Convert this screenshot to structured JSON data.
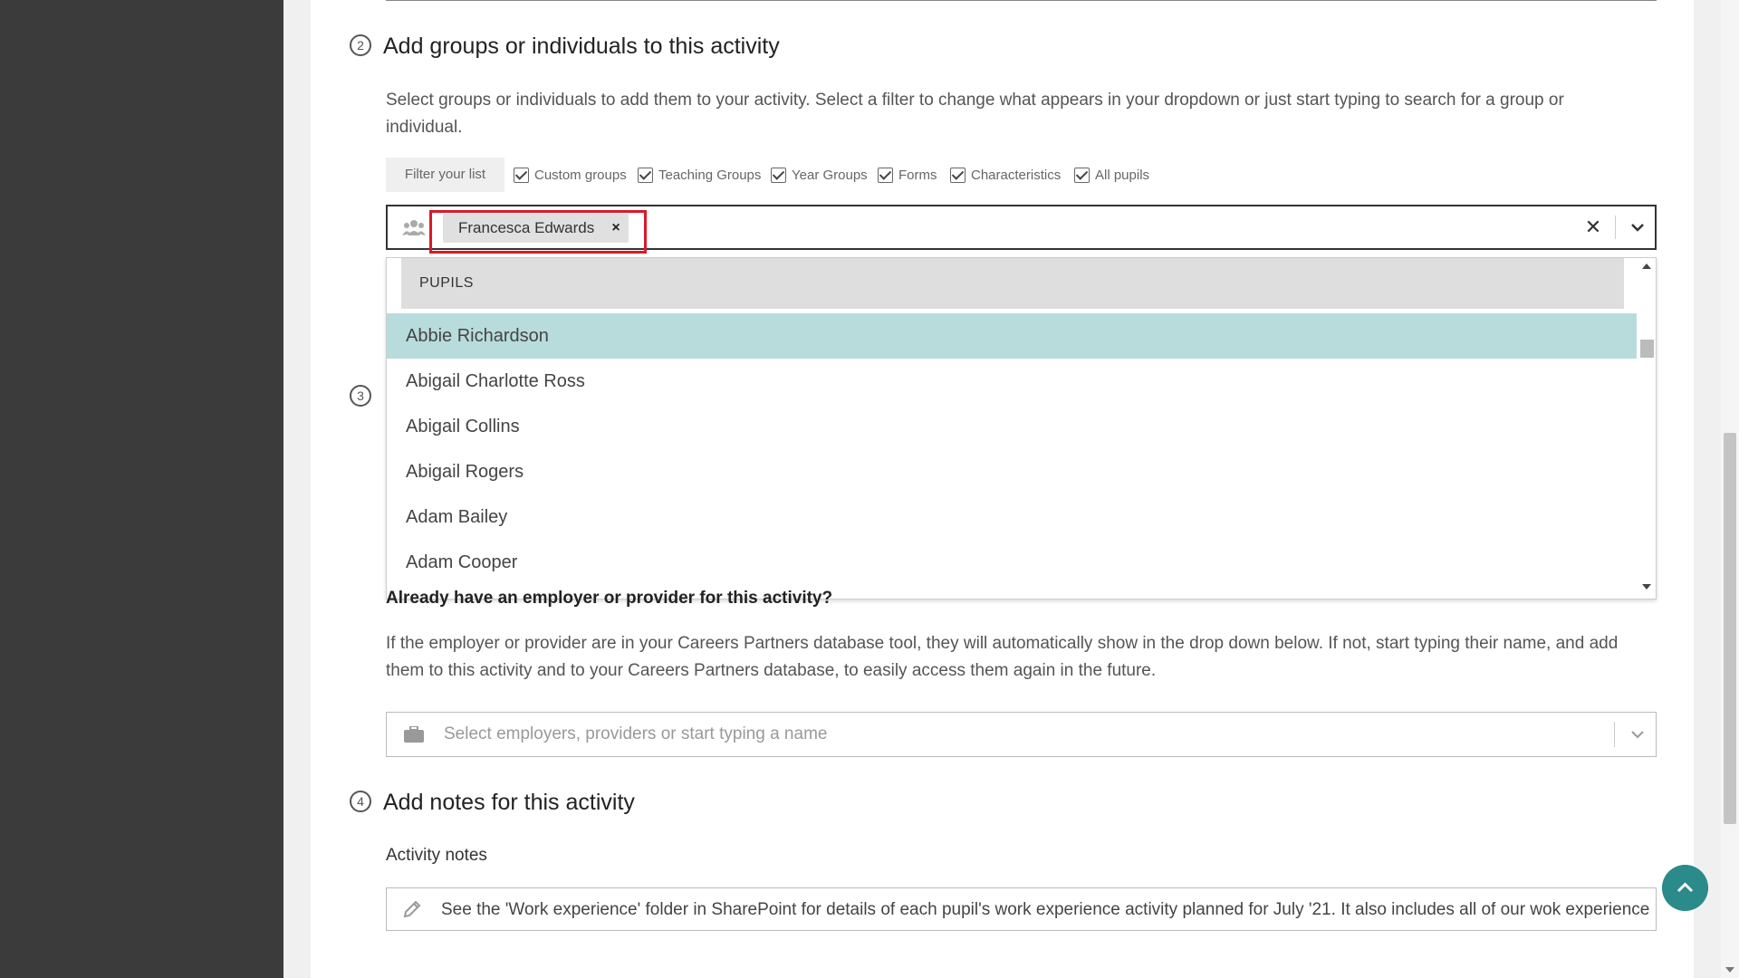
{
  "section2": {
    "number": "2",
    "title": "Add groups or individuals to this activity",
    "description": "Select groups or individuals to add them to your activity. Select a filter to change what appears in your dropdown or just start typing to search for a group or individual."
  },
  "filters": {
    "label": "Filter your list",
    "options": [
      "Custom groups",
      "Teaching Groups",
      "Year Groups",
      "Forms",
      "Characteristics",
      "All pupils"
    ]
  },
  "select": {
    "selected_chip": "Francesca Edwards",
    "chip_remove_glyph": "×",
    "clear_glyph": "✕"
  },
  "dropdown": {
    "header": "PUPILS",
    "items": [
      "Abbie Richardson",
      "Abigail Charlotte Ross",
      "Abigail Collins",
      "Abigail Rogers",
      "Adam Bailey",
      "Adam Cooper"
    ],
    "active_index": 0
  },
  "section3": {
    "number": "3",
    "question": "Already have an employer or provider for this activity?",
    "description": "If the employer or provider are in your Careers Partners database tool, they will automatically show in the drop down below. If not, start typing their name, and add them to this activity and to your Careers Partners database, to easily access them again in the future.",
    "employer_placeholder": "Select employers, providers or start typing a name"
  },
  "section4": {
    "number": "4",
    "title": "Add notes for this activity",
    "notes_label": "Activity notes",
    "notes_value": "See the 'Work experience' folder in SharePoint for details of each pupil's work experience activity planned for July '21. It also includes all of our wok experience"
  },
  "colors": {
    "highlight": "#b8dcdc",
    "annotation_red": "#d9192a",
    "teal_button": "#2b8a8a"
  },
  "icons": {
    "group": "group-icon",
    "briefcase": "briefcase-icon",
    "pencil": "pencil-icon",
    "chevron": "chevron-down-icon",
    "to_top": "chevron-up-icon"
  }
}
